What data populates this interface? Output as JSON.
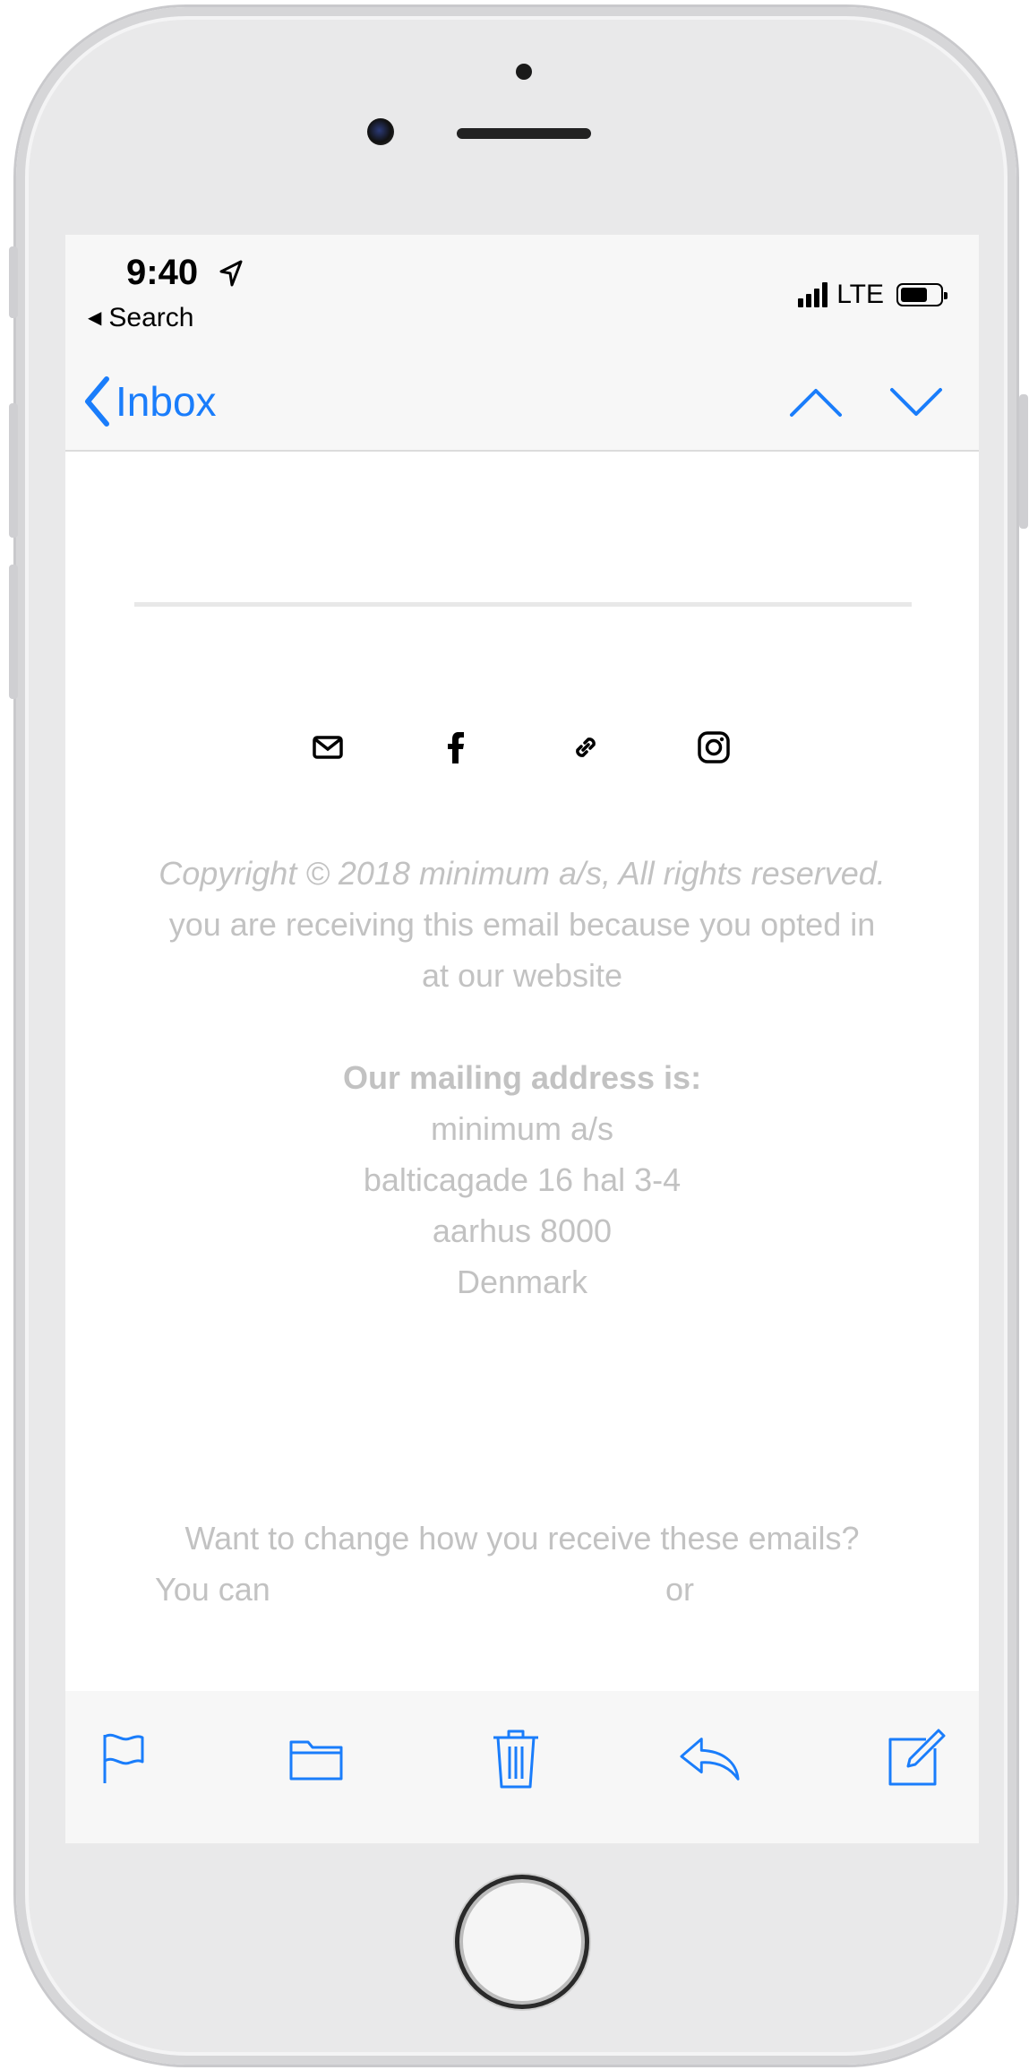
{
  "status_bar": {
    "time": "9:40",
    "back_app": "Search",
    "network": "LTE"
  },
  "nav": {
    "back_label": "Inbox",
    "icons": [
      "chevron-left-icon",
      "chevron-up-icon",
      "chevron-down-icon"
    ],
    "accent_color": "#1a7dfb"
  },
  "email": {
    "social_icons": [
      "mail-icon",
      "facebook-icon",
      "link-icon",
      "instagram-icon"
    ],
    "copyright": "Copyright © 2018 minimum a/s, All rights reserved.",
    "reason_line1": "you are receiving this email because you opted in",
    "reason_line2": "at our website",
    "address_heading": "Our mailing address is:",
    "address_lines": [
      "minimum a/s",
      "balticagade 16 hal 3-4",
      "aarhus 8000",
      "Denmark"
    ],
    "change_prompt": "Want to change how you receive these emails?",
    "you_can": "You can",
    "or": "or",
    "text_color": "#c2c2c2"
  },
  "toolbar": {
    "icons": [
      "flag-icon",
      "folder-icon",
      "trash-icon",
      "reply-icon",
      "compose-icon"
    ]
  }
}
